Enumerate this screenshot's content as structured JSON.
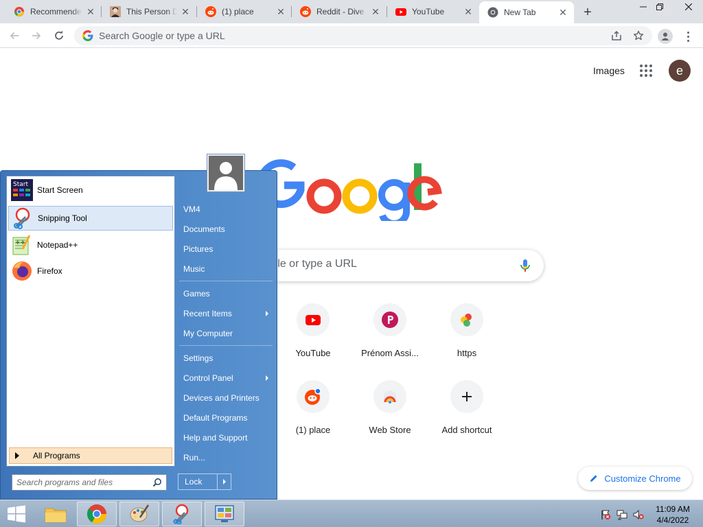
{
  "browser": {
    "tabs": [
      {
        "title": "Recommende",
        "icon": "chrome-web-store-icon"
      },
      {
        "title": "This Person D",
        "icon": "person-photo-icon"
      },
      {
        "title": "(1) place",
        "icon": "reddit-icon"
      },
      {
        "title": "Reddit - Dive",
        "icon": "reddit-icon"
      },
      {
        "title": "YouTube",
        "icon": "youtube-icon"
      },
      {
        "title": "New Tab",
        "icon": "chrome-icon",
        "active": true
      }
    ],
    "new_tab_symbol": "+",
    "omnibox_placeholder": "Search Google or type a URL"
  },
  "ntp": {
    "images_link": "Images",
    "avatar_letter": "e",
    "search_placeholder": "Search Google or type a URL",
    "shortcuts": [
      {
        "label": "YouTube",
        "icon": "youtube-icon"
      },
      {
        "label": "Prénom Assi...",
        "icon": "p-letter-icon"
      },
      {
        "label": "https",
        "icon": "multicolor-dots-icon"
      },
      {
        "label": "(1) place",
        "icon": "reddit-icon"
      },
      {
        "label": "Web Store",
        "icon": "chrome-web-store-icon"
      },
      {
        "label": "Add shortcut",
        "icon": "plus-icon"
      }
    ],
    "customize_label": "Customize Chrome",
    "colors": {
      "blue": "#4285F4",
      "red": "#EA4335",
      "yellow": "#FBBC05",
      "green": "#34A853"
    }
  },
  "start_menu": {
    "pinned": [
      {
        "label": "Start Screen",
        "icon": "start-screen-icon"
      },
      {
        "label": "Snipping Tool",
        "icon": "snipping-tool-icon"
      },
      {
        "label": "Notepad++",
        "icon": "notepad-plus-plus-icon"
      },
      {
        "label": "Firefox",
        "icon": "firefox-icon"
      }
    ],
    "start_screen_icon_text": "Start",
    "all_programs": "All Programs",
    "search_placeholder": "Search programs and files",
    "right_items": [
      "VM4",
      "Documents",
      "Pictures",
      "Music",
      "Games",
      "Recent Items",
      "My Computer",
      "Settings",
      "Control Panel",
      "Devices and Printers",
      "Default Programs",
      "Help and Support",
      "Run..."
    ],
    "lock_label": "Lock"
  },
  "taskbar": {
    "apps": [
      "file-explorer-icon",
      "chrome-icon",
      "paint-icon",
      "snipping-tool-icon",
      "control-panel-icon"
    ],
    "time": "11:09 AM",
    "date": "4/4/2022"
  }
}
